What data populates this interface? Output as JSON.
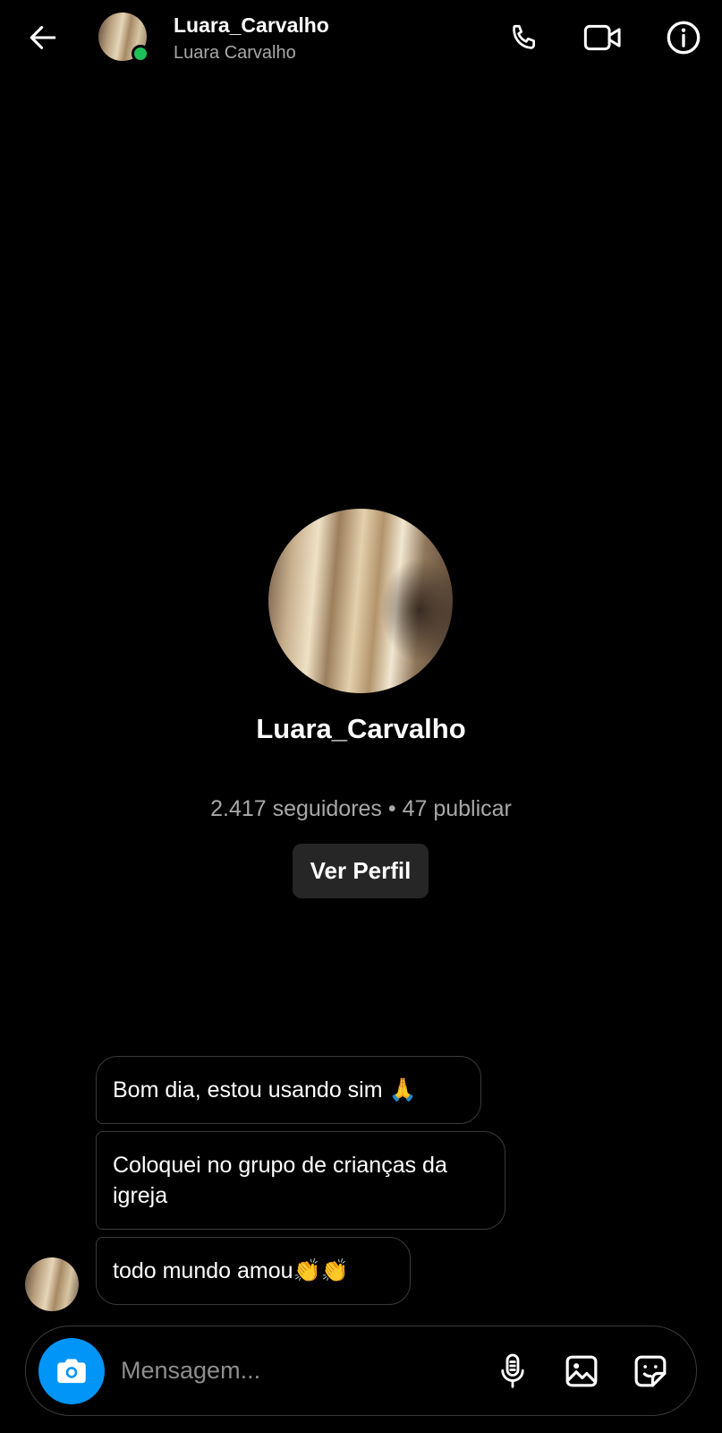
{
  "header": {
    "username": "Luara_Carvalho",
    "full_name": "Luara Carvalho",
    "online": true,
    "icons": {
      "back": "arrow-left-icon",
      "call": "phone-icon",
      "video": "video-camera-icon",
      "info": "info-icon"
    }
  },
  "profile": {
    "username": "Luara_Carvalho",
    "stats": "2.417 seguidores • 47 publicar",
    "view_profile_label": "Ver Perfil"
  },
  "messages": [
    {
      "text": "Bom dia, estou usando sim 🙏"
    },
    {
      "text": "Coloquei no grupo de crianças da igreja"
    },
    {
      "text": "todo mundo amou👏👏"
    }
  ],
  "composer": {
    "placeholder": "Mensagem...",
    "icons": {
      "camera": "camera-icon",
      "mic": "microphone-icon",
      "gallery": "image-icon",
      "sticker": "sticker-icon"
    }
  },
  "colors": {
    "background": "#000000",
    "bubble_border": "#3a3a3a",
    "accent": "#0095f6",
    "online": "#1ec05a",
    "secondary_text": "#a8a8a8"
  }
}
